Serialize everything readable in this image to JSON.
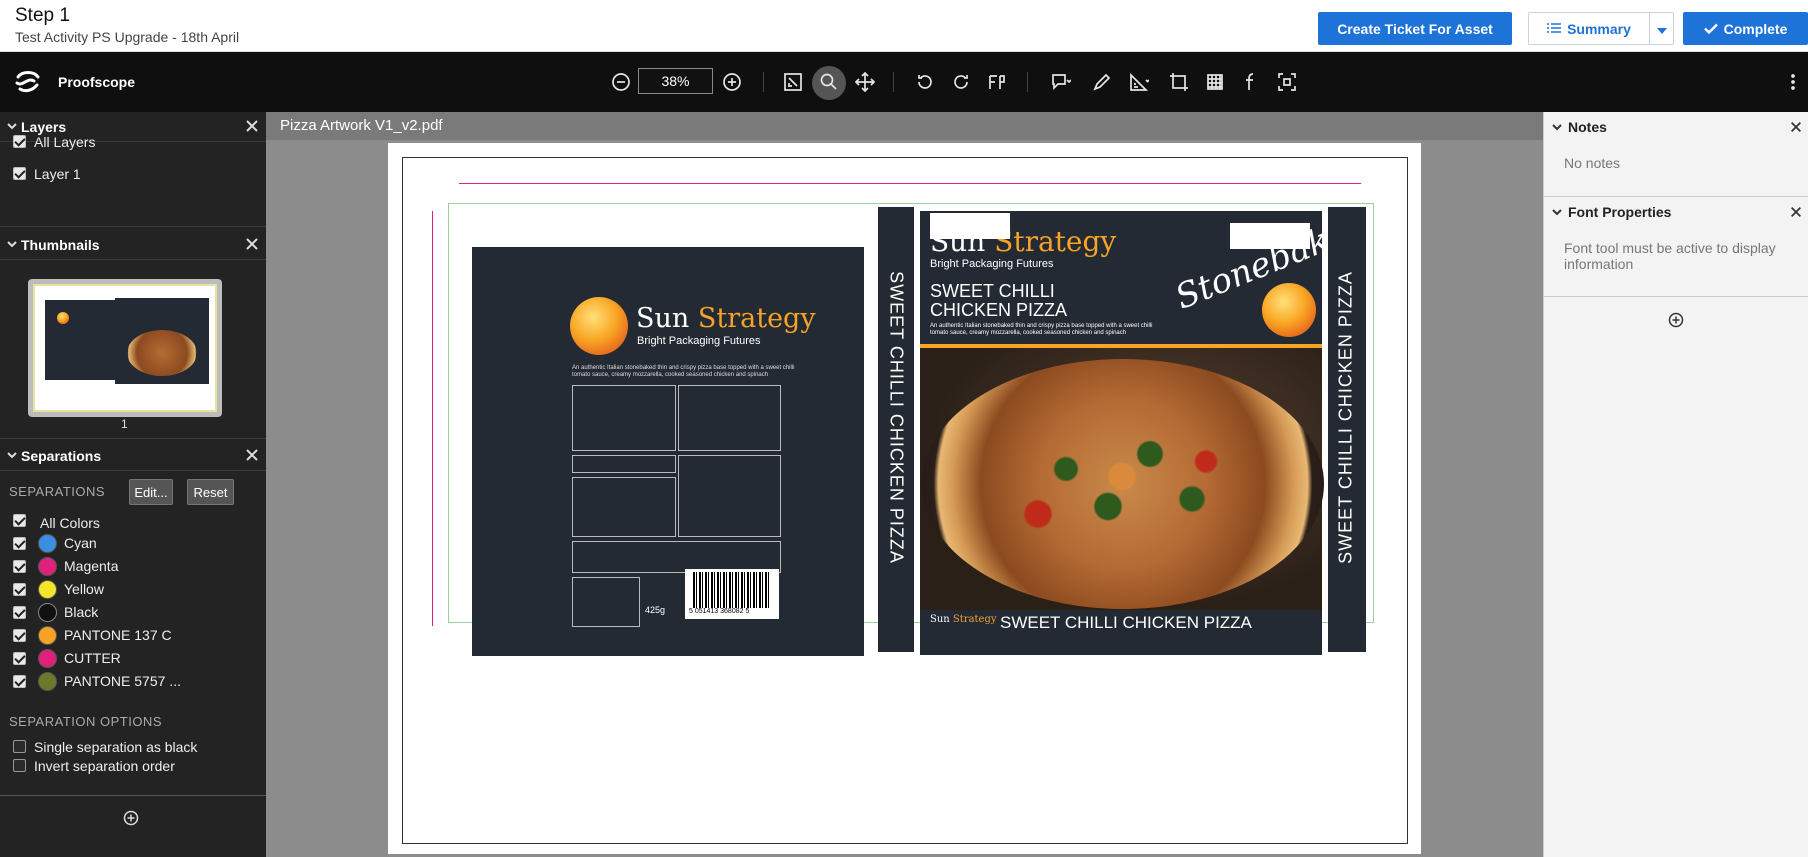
{
  "header": {
    "step_title": "Step 1",
    "subtitle": "Test Activity PS Upgrade - 18th April",
    "create_ticket_label": "Create Ticket For Asset",
    "summary_label": "Summary",
    "complete_label": "Complete"
  },
  "toolbar": {
    "brand": "Proofscope",
    "zoom_value": "38%"
  },
  "layers": {
    "title": "Layers",
    "items": [
      {
        "label": "All Layers",
        "checked": true
      },
      {
        "label": "Layer 1",
        "checked": true
      }
    ]
  },
  "thumbnails": {
    "title": "Thumbnails",
    "page_number": "1"
  },
  "separations": {
    "title": "Separations",
    "section_label": "SEPARATIONS",
    "edit_label": "Edit...",
    "reset_label": "Reset",
    "all_colors_label": "All Colors",
    "items": [
      {
        "label": "Cyan",
        "color": "#3a8fe0"
      },
      {
        "label": "Magenta",
        "color": "#e0207a"
      },
      {
        "label": "Yellow",
        "color": "#f5e52a"
      },
      {
        "label": "Black",
        "color": "#111111"
      },
      {
        "label": "PANTONE 137 C",
        "color": "#f7a325"
      },
      {
        "label": "CUTTER",
        "color": "#e0207a"
      },
      {
        "label": "PANTONE 5757 ...",
        "color": "#6b7a2a"
      }
    ],
    "options_label": "SEPARATION OPTIONS",
    "option_single": "Single separation as black",
    "option_invert": "Invert separation order"
  },
  "document": {
    "file_name": "Pizza Artwork V1_v2.pdf",
    "brand_name_1": "Sun",
    "brand_name_2": "Strategy",
    "brand_tagline": "Bright Packaging Futures",
    "product_line_1": "SWEET CHILLI",
    "product_line_2": "CHICKEN PIZZA",
    "product_full": "SWEET CHILLI CHICKEN PIZZA",
    "description": "An authentic Italian stonebaked thin and crispy pizza base topped with a sweet chilli tomato sauce, creamy mozzarella, cooked seasoned chicken and spinach",
    "script_brand": "Stonebaked",
    "weight": "425g",
    "barcode_digits": "5 051413 368082 5"
  },
  "notes": {
    "title": "Notes",
    "empty_text": "No notes"
  },
  "font_properties": {
    "title": "Font Properties",
    "message": "Font tool must be active to display information"
  },
  "colors": {
    "accent": "#1e73d8",
    "panel_dark": "#232323",
    "toolbar": "#0f0f0f",
    "canvas": "#8c8c8c",
    "package": "#232a33",
    "brand_orange": "#f7a325"
  }
}
